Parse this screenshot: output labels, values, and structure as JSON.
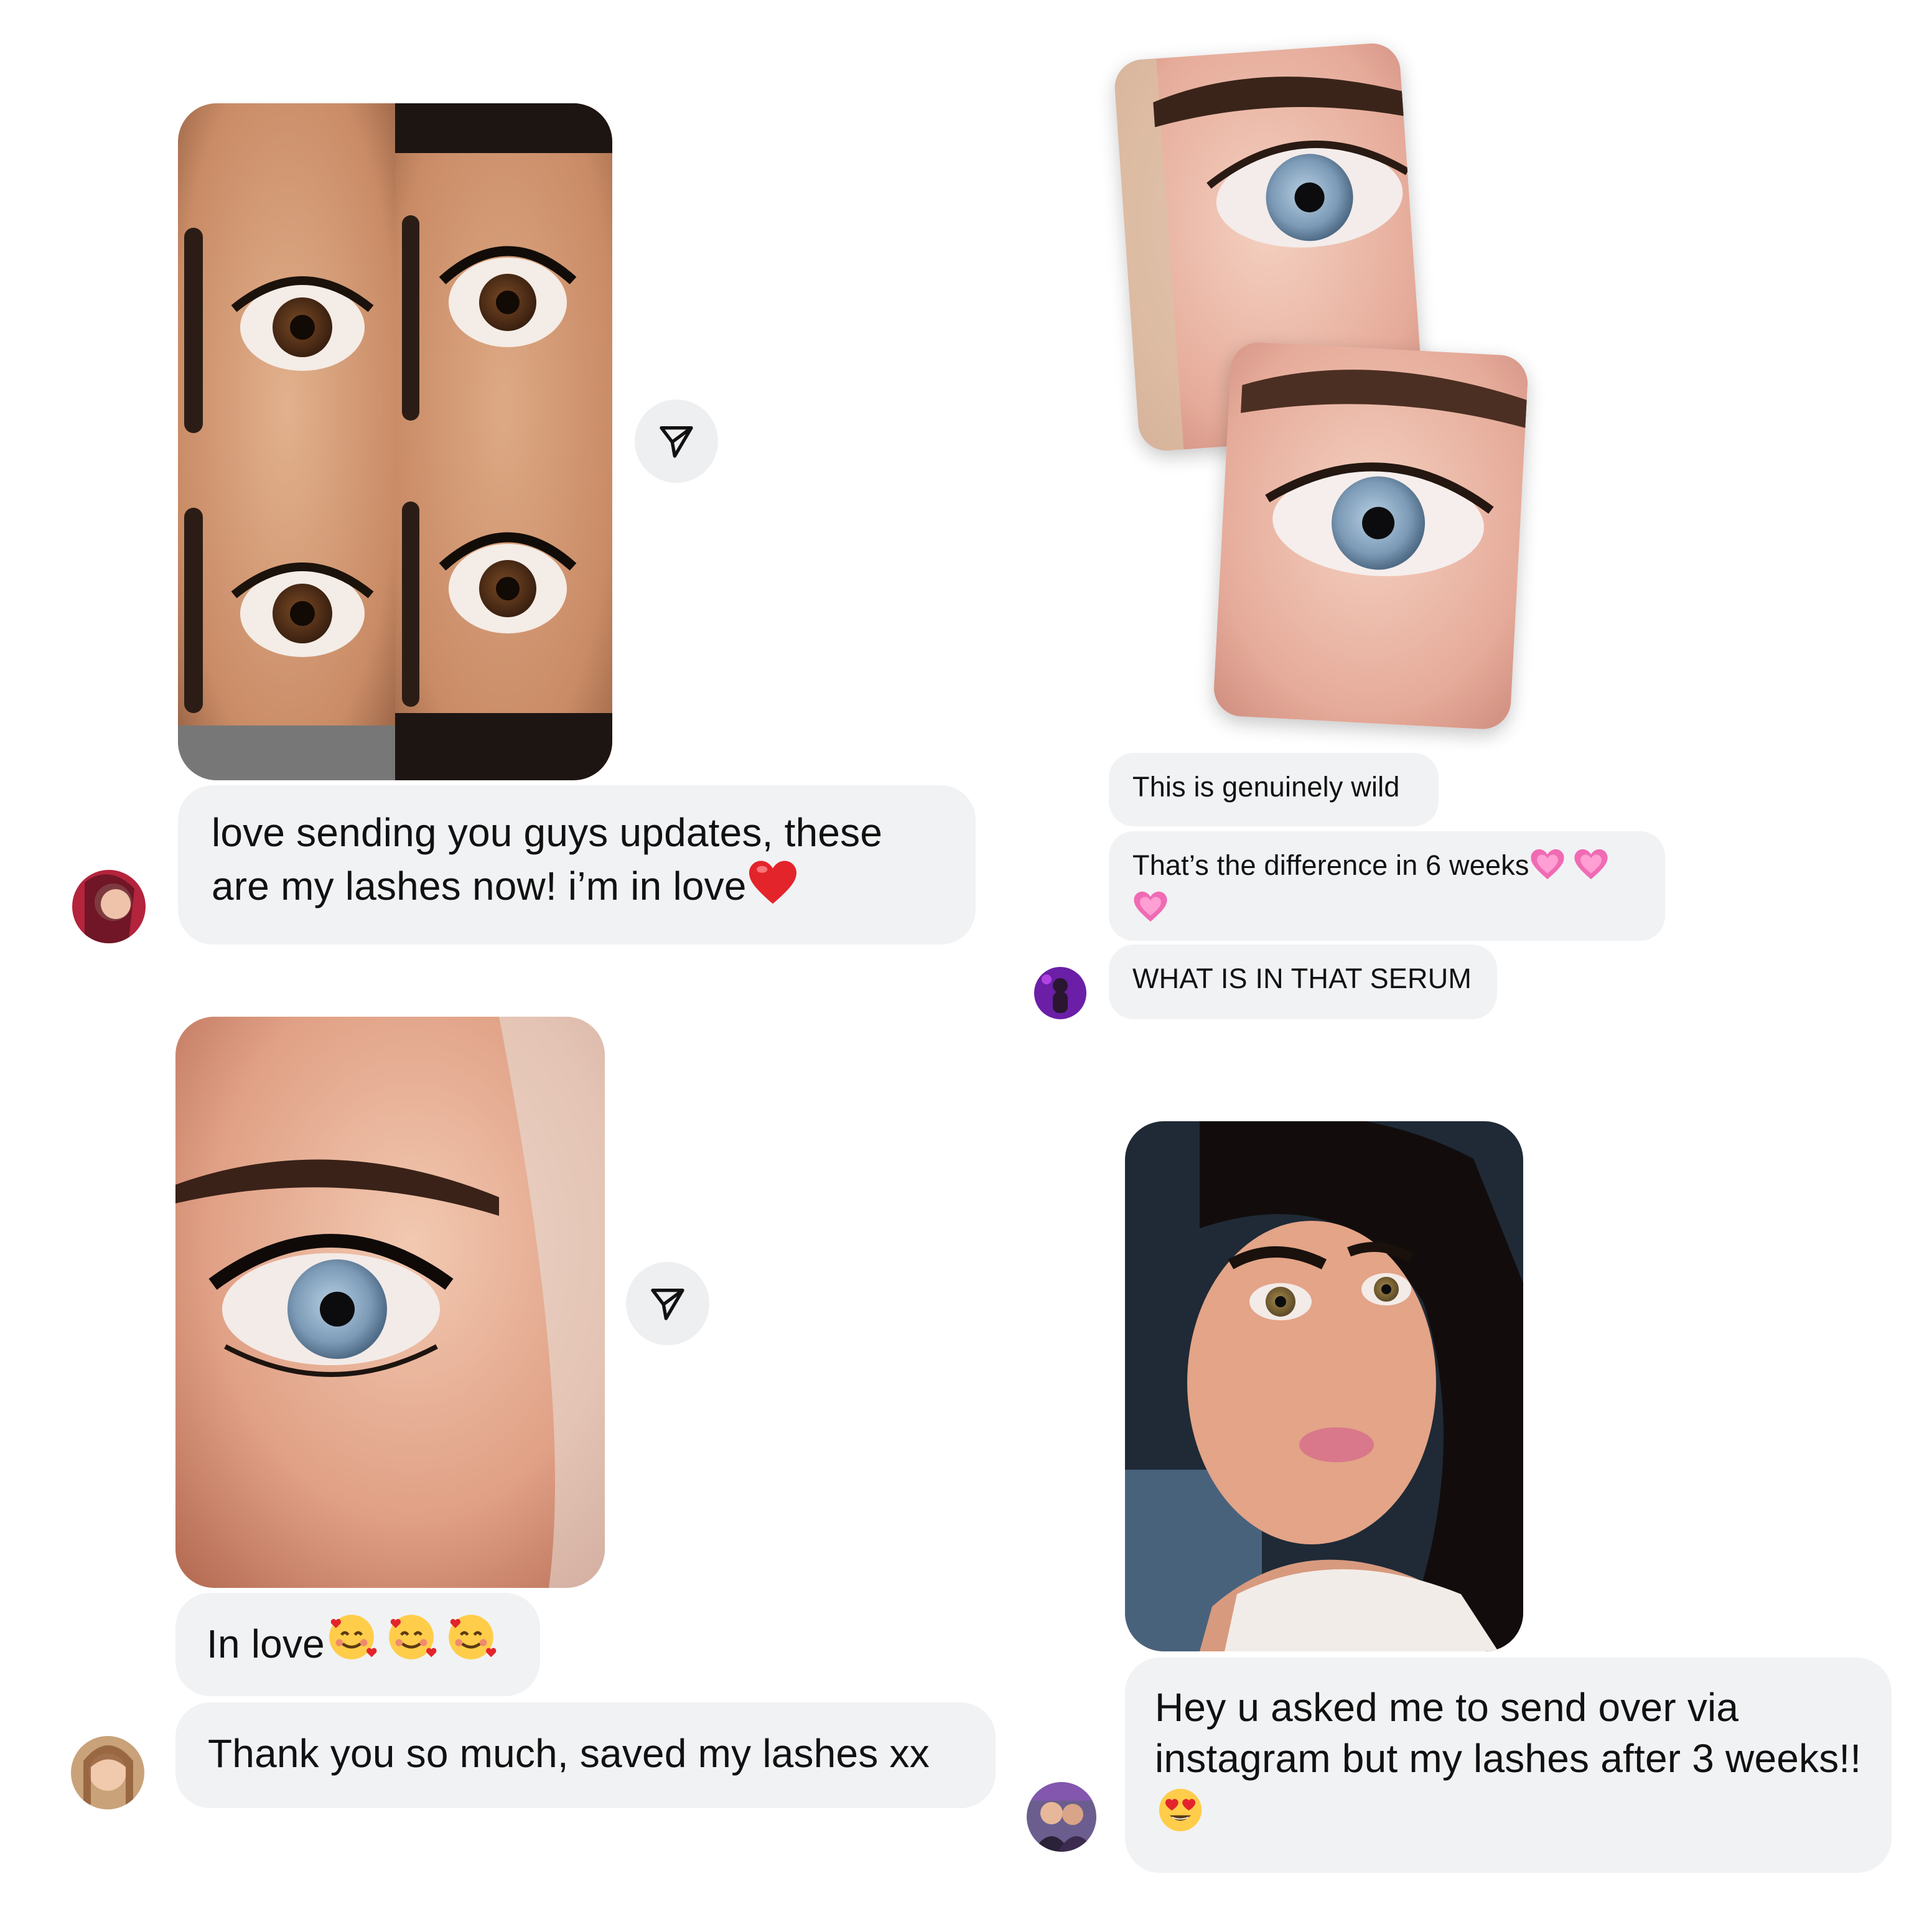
{
  "conversations": [
    {
      "id": "top-left",
      "messages": [
        "love sending you guys updates, these are my lashes now! i’m in love"
      ],
      "emojis": [
        "heart"
      ]
    },
    {
      "id": "top-right",
      "messages": [
        "This is genuinely wild",
        "That’s the difference in 6 weeks",
        "WHAT IS IN THAT SERUM"
      ],
      "emojis": [
        "pink-heart",
        "pink-heart",
        "pink-heart"
      ]
    },
    {
      "id": "bottom-left",
      "messages": [
        "In love",
        "Thank you so much, saved my lashes xx"
      ],
      "emojis": [
        "smiling-face-with-hearts",
        "smiling-face-with-hearts",
        "smiling-face-with-hearts"
      ]
    },
    {
      "id": "bottom-right",
      "messages": [
        "Hey u asked me to send over via instagram but my lashes after 3 weeks!!"
      ],
      "emojis": [
        "heart-eyes"
      ]
    }
  ],
  "icons": {
    "share": "send-paper-plane-icon"
  },
  "colors": {
    "bubble": "#f1f2f4",
    "share_bg": "#eeeff1",
    "background": "#ffffff"
  }
}
